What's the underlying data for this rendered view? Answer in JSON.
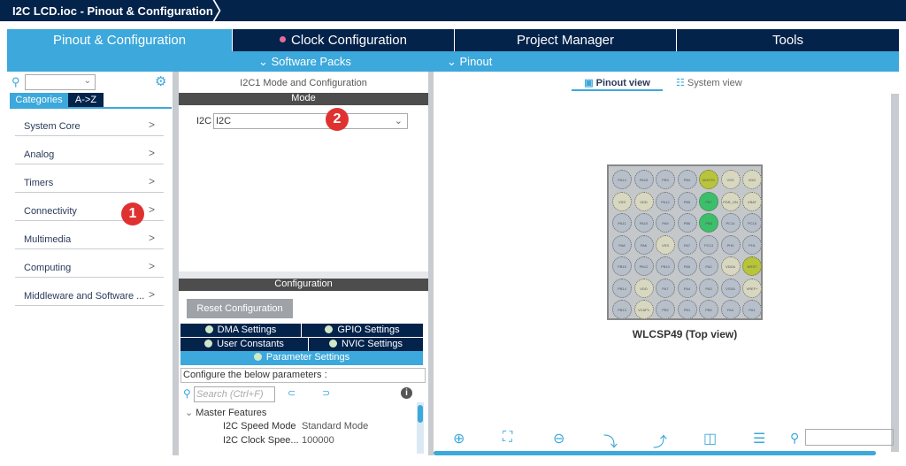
{
  "window": {
    "title": "I2C LCD.ioc - Pinout & Configuration"
  },
  "tabs": [
    {
      "label": "Pinout & Configuration"
    },
    {
      "label": "Clock Configuration"
    },
    {
      "label": "Project Manager"
    },
    {
      "label": "Tools"
    }
  ],
  "subtabs": {
    "software_packs": "Software Packs",
    "pinout": "Pinout"
  },
  "left": {
    "search_value": "",
    "category_tabs": [
      "Categories",
      "A->Z"
    ],
    "categories": [
      "System Core",
      "Analog",
      "Timers",
      "Connectivity",
      "Multimedia",
      "Computing",
      "Middleware and Software ..."
    ]
  },
  "middle": {
    "title": "I2C1 Mode and Configuration",
    "mode_header": "Mode",
    "i2c_label": "I2C",
    "i2c_value": "I2C",
    "config_header": "Configuration",
    "reset_button": "Reset Configuration",
    "settings_tabs": [
      "DMA Settings",
      "GPIO Settings",
      "User Constants",
      "NVIC Settings",
      "Parameter Settings"
    ],
    "configure_label": "Configure the below parameters :",
    "search_placeholder": "Search (Ctrl+F)",
    "tree": {
      "group": "Master Features",
      "params": [
        {
          "name": "I2C Speed Mode",
          "value": "Standard Mode"
        },
        {
          "name": "I2C Clock Spee...",
          "value": "100000"
        }
      ]
    }
  },
  "right": {
    "view_tabs": [
      "Pinout view",
      "System view"
    ],
    "chip_label": "WLCSP49 (Top view)",
    "search_value": "",
    "pins": [
      [
        "PA14",
        "PA15",
        "PB3",
        "PB4",
        "BOOT0",
        "VSS",
        "VDD"
      ],
      [
        "VSS",
        "VDD",
        "PA12",
        "PB5",
        "PB7",
        "PDR_ON",
        "VBAT"
      ],
      [
        "PA11",
        "PA10",
        "PA9",
        "PB6",
        "PB8",
        "PC14",
        "PC15"
      ],
      [
        "PA8",
        "PA6",
        "VSS",
        "PA7",
        "PC13",
        "PH0",
        "PH1"
      ],
      [
        "PB15",
        "PB12",
        "PB10",
        "PA5",
        "PA2",
        "VDDA",
        "NRST"
      ],
      [
        "PB14",
        "VDD",
        "PA7",
        "PA4",
        "PA3",
        "VSSA",
        "VREF+"
      ],
      [
        "PB13",
        "VCAP1",
        "PB2",
        "PB1",
        "PB0",
        "PA4",
        "PA1"
      ]
    ],
    "pin_types": [
      [
        "n",
        "n",
        "n",
        "n",
        "b",
        "p",
        "p"
      ],
      [
        "p",
        "p",
        "n",
        "n",
        "a",
        "p",
        "p"
      ],
      [
        "n",
        "n",
        "n",
        "n",
        "a",
        "n",
        "n"
      ],
      [
        "n",
        "n",
        "p",
        "n",
        "n",
        "n",
        "n"
      ],
      [
        "n",
        "n",
        "n",
        "n",
        "n",
        "p",
        "b"
      ],
      [
        "n",
        "p",
        "n",
        "n",
        "n",
        "n",
        "p"
      ],
      [
        "n",
        "p",
        "n",
        "n",
        "n",
        "n",
        "n"
      ]
    ]
  },
  "annotations": [
    "1",
    "2"
  ],
  "colors": {
    "navy": "#03234b",
    "accent": "#3ca8db",
    "pin_normal": "#b6bfca",
    "pin_power": "#d8d8c0",
    "pin_boot": "#b8c43a",
    "pin_active": "#3cbf6a"
  }
}
